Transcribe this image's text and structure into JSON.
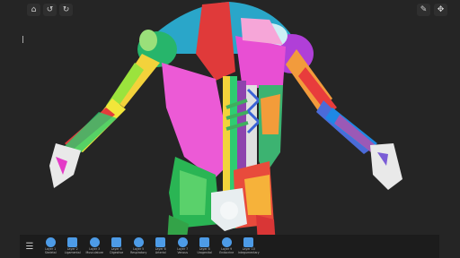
{
  "toolbar": {
    "home_icon": "home-icon",
    "undo_icon": "undo-icon",
    "redo_icon": "redo-icon",
    "pen_icon": "pen-icon",
    "move_icon": "move-icon"
  },
  "layers": [
    {
      "line1": "Layer 1",
      "line2": "Skeletal",
      "icon": "skull-icon"
    },
    {
      "line1": "Layer 2",
      "line2": "Ligamental",
      "icon": "ligament-icon"
    },
    {
      "line1": "Layer 3",
      "line2": "Musculature",
      "icon": "muscle-icon"
    },
    {
      "line1": "Layer 4",
      "line2": "Digestive",
      "icon": "stomach-icon"
    },
    {
      "line1": "Layer 5",
      "line2": "Respiratory",
      "icon": "lungs-icon"
    },
    {
      "line1": "Layer 6",
      "line2": "Arterial",
      "icon": "arteries-icon"
    },
    {
      "line1": "Layer 7",
      "line2": "Venous",
      "icon": "heart-icon"
    },
    {
      "line1": "Layer 8",
      "line2": "Urogenital",
      "icon": "kidney-icon"
    },
    {
      "line1": "Layer 9",
      "line2": "Endocrine",
      "icon": "gland-icon"
    },
    {
      "line1": "Layer 10",
      "line2": "Integumentary",
      "icon": "skin-icon"
    }
  ],
  "colors": {
    "background": "#252525",
    "bar": "#1c1c1c",
    "icon_accent": "#4d9be6"
  }
}
